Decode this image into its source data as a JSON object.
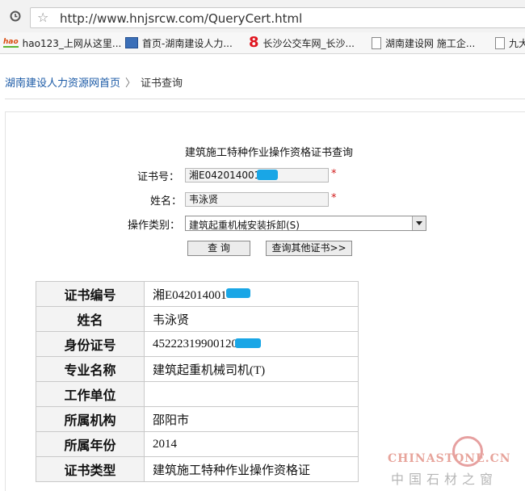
{
  "browser": {
    "url": "http://www.hnjsrcw.com/QueryCert.html",
    "bookmarks": [
      {
        "label": "hao123_上网从这里...",
        "icon": "hao123-icon"
      },
      {
        "label": "首页-湖南建设人力...",
        "icon": "site-icon"
      },
      {
        "label": "长沙公交车网_长沙...",
        "icon": "bus8-icon"
      },
      {
        "label": "湖南建设网 施工企...",
        "icon": "page-icon"
      },
      {
        "label": "九大",
        "icon": "page-icon"
      }
    ]
  },
  "breadcrumb": {
    "home": "湖南建设人力资源网首页",
    "separator": "〉",
    "current": "证书查询"
  },
  "form": {
    "title": "建筑施工特种作业操作资格证书查询",
    "cert_no_label": "证书号：",
    "cert_no_value": "湘E042014001",
    "name_label": "姓名：",
    "name_value": "韦泳贤",
    "type_label": "操作类别：",
    "type_value": "建筑起重机械安装拆卸(S)",
    "required_mark": "*",
    "query_button": "查  询",
    "other_button": "查询其他证书>>"
  },
  "result": {
    "rows": [
      {
        "key": "证书编号",
        "value": "湘E042014001"
      },
      {
        "key": "姓名",
        "value": "韦泳贤"
      },
      {
        "key": "身份证号",
        "value": "45222319900120"
      },
      {
        "key": "专业名称",
        "value": "建筑起重机械司机(T)"
      },
      {
        "key": "工作单位",
        "value": ""
      },
      {
        "key": "所属机构",
        "value": "邵阳市"
      },
      {
        "key": "所属年份",
        "value": "2014"
      },
      {
        "key": "证书类型",
        "value": "建筑施工特种作业操作资格证"
      }
    ]
  },
  "watermark": {
    "en": "CHINASTONE.CN",
    "cn": "中国石材之窗"
  },
  "colors": {
    "link": "#1b5aa6",
    "required": "#d01818",
    "mask": "#19a6e6",
    "table_key_bg": "#f3f3f3"
  }
}
